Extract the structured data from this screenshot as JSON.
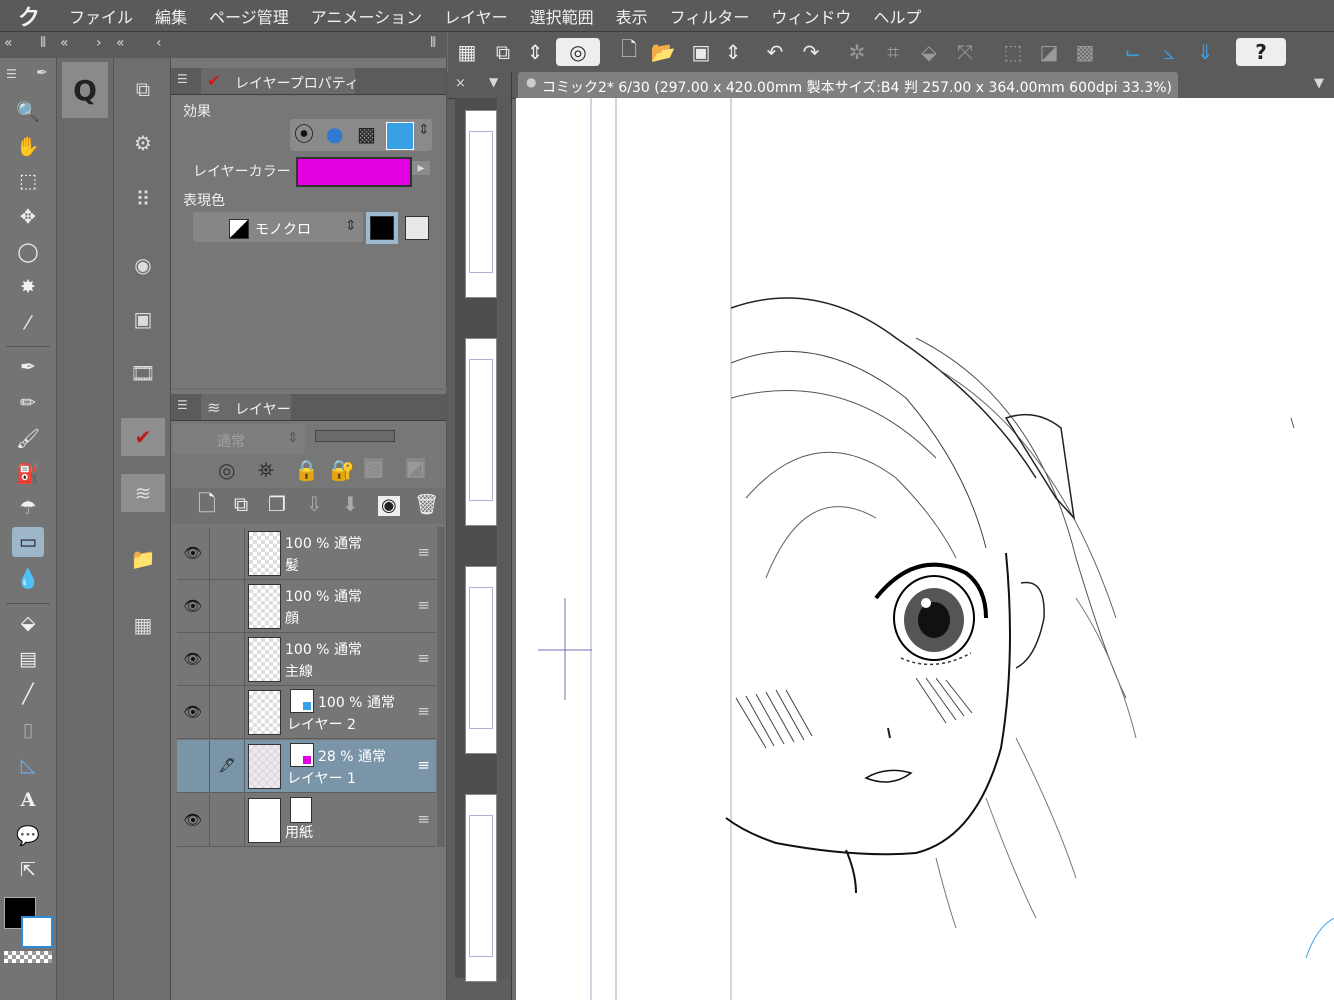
{
  "app": {
    "logo": "ク"
  },
  "menu": [
    "ファイル",
    "編集",
    "ページ管理",
    "アニメーション",
    "レイヤー",
    "選択範囲",
    "表示",
    "フィルター",
    "ウィンドウ",
    "ヘルプ"
  ],
  "document_tab": {
    "close": "×",
    "title": "コミック2* 6/30 (297.00 x 420.00mm 製本サイズ:B4 判 257.00 x 364.00mm 600dpi 33.3%)"
  },
  "layer_property": {
    "title": "レイヤープロパティ",
    "effect_label": "効果",
    "layer_color_label": "レイヤーカラー",
    "layer_color": "#e000e0",
    "expression_label": "表現色",
    "expression_value": "モノクロ"
  },
  "layer_panel": {
    "title": "レイヤー",
    "blend_mode": "通常",
    "layers": [
      {
        "opacity": "100 %",
        "mode": "通常",
        "name": "髪",
        "visible": true
      },
      {
        "opacity": "100 %",
        "mode": "通常",
        "name": "顔",
        "visible": true
      },
      {
        "opacity": "100 %",
        "mode": "通常",
        "name": "主線",
        "visible": true
      },
      {
        "opacity": "100 %",
        "mode": "通常",
        "name": "レイヤー 2",
        "visible": true
      },
      {
        "opacity": "28 %",
        "mode": "通常",
        "name": "レイヤー 1",
        "visible": false,
        "selected": true
      },
      {
        "opacity": "",
        "mode": "",
        "name": "用紙",
        "visible": true
      }
    ]
  },
  "tools_text_glyph": "A",
  "colors": {
    "accent_blue": "#3aa0e6",
    "main_color": "#000000",
    "sub_color": "#ffffff",
    "layer_magenta": "#e000e0"
  }
}
